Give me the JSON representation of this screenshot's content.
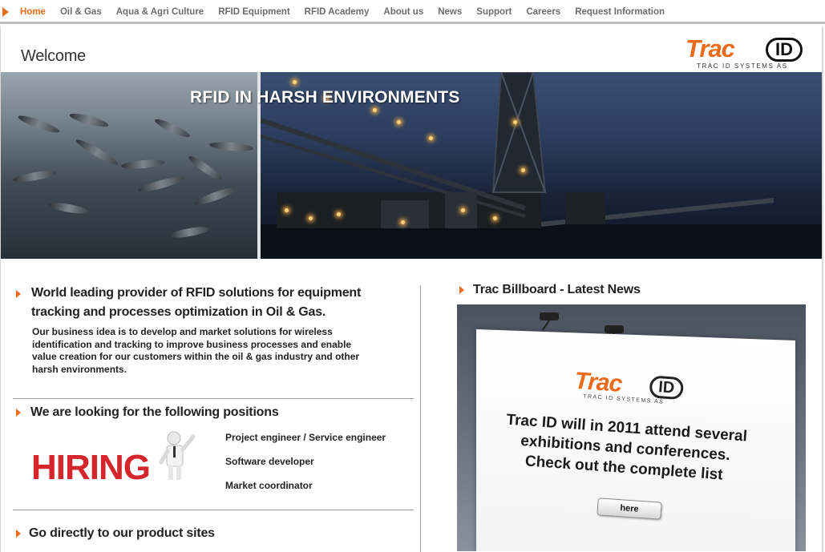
{
  "nav": {
    "items": [
      {
        "label": "Home",
        "active": true
      },
      {
        "label": "Oil & Gas",
        "active": false
      },
      {
        "label": "Aqua & Agri Culture",
        "active": false
      },
      {
        "label": "RFID Equipment",
        "active": false
      },
      {
        "label": "RFID Academy",
        "active": false
      },
      {
        "label": "About us",
        "active": false
      },
      {
        "label": "News",
        "active": false
      },
      {
        "label": "Support",
        "active": false
      },
      {
        "label": "Careers",
        "active": false
      },
      {
        "label": "Request Information",
        "active": false
      }
    ]
  },
  "page": {
    "welcome": "Welcome"
  },
  "logo": {
    "trac": "Trac",
    "id": "ID",
    "subtitle": "TRAC ID SYSTEMS AS"
  },
  "banner": {
    "headline": "RFID IN  HARSH ENVIRONMENTS"
  },
  "intro": {
    "title_line1": "World leading provider of RFID solutions for equipment",
    "title_line2": "tracking and processes optimization in Oil & Gas.",
    "body": "Our business idea is to develop and market solutions for wireless identification and tracking to improve business processes and enable value creation for our customers within the oil & gas industry and other harsh environments."
  },
  "positions": {
    "title": "We are looking for the following positions",
    "hiring_word": "HIRING",
    "items": [
      "Project engineer / Service engineer",
      "Software developer",
      "Market coordinator"
    ]
  },
  "products": {
    "title": "Go directly to our product sites"
  },
  "billboard": {
    "title": "Trac Billboard - Latest News",
    "logo_trac": "Trac",
    "logo_id": "ID",
    "logo_sub": "TRAC ID SYSTEMS AS",
    "line1": "Trac ID will in 2011 attend several",
    "line2": "exhibitions and conferences.",
    "line3": "Check out the complete list",
    "button": "here"
  },
  "colors": {
    "accent": "#ec6b1a",
    "hiring_red": "#d4262b",
    "text": "#222222",
    "nav_text": "#6c6c6c"
  }
}
